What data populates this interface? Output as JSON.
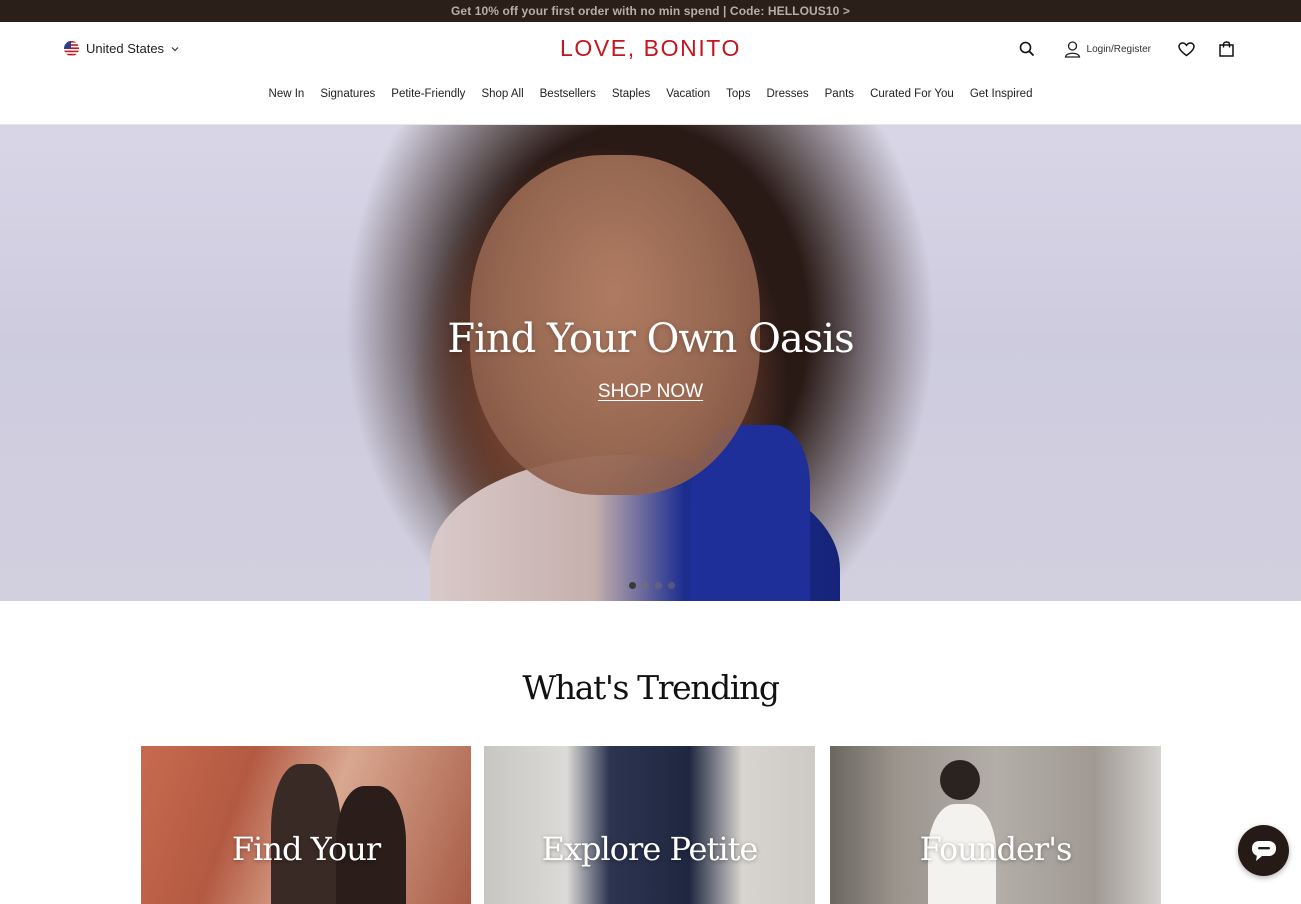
{
  "promo": {
    "text": "Get 10% off your first order with no min spend | Code: HELLOUS10 >"
  },
  "header": {
    "region": "United States",
    "logo": "LOVE, BONITO",
    "login_label": "Login/Register",
    "icons": [
      "search-icon",
      "user-icon",
      "heart-icon",
      "shopping-bag-icon"
    ]
  },
  "nav": {
    "items": [
      "New In",
      "Signatures",
      "Petite-Friendly",
      "Shop All",
      "Bestsellers",
      "Staples",
      "Vacation",
      "Tops",
      "Dresses",
      "Pants",
      "Curated For You",
      "Get Inspired"
    ]
  },
  "hero": {
    "title": "Find Your Own Oasis",
    "cta": "SHOP NOW",
    "slides_total": 4,
    "active_slide": 1
  },
  "trending": {
    "title": "What's Trending",
    "cards": [
      {
        "label": "Find Your"
      },
      {
        "label": "Explore Petite"
      },
      {
        "label": "Founder's"
      }
    ]
  },
  "colors": {
    "promo_bg": "#2b1f1a",
    "brand_red": "#c4161c",
    "chat_bg": "#261a16"
  }
}
